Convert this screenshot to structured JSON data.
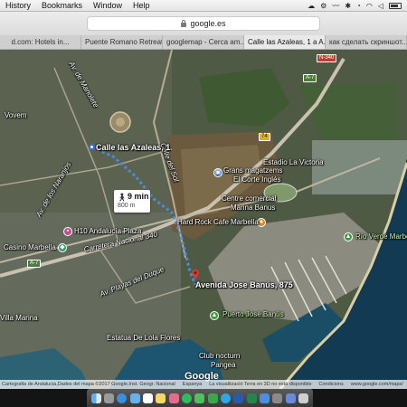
{
  "menubar": {
    "items": [
      "History",
      "Bookmarks",
      "Window",
      "Help"
    ]
  },
  "toolbar": {
    "address": "google.es"
  },
  "tabs": [
    {
      "label": "d.com: Hotels in..."
    },
    {
      "label": "Puente Romano Retreat..."
    },
    {
      "label": "googlemap - Cerca am..."
    },
    {
      "label": "Calle las Azaleas, 1 a A..."
    },
    {
      "label": "как сделать скриншот..."
    }
  ],
  "map": {
    "labels": {
      "vovem": "Vovem",
      "calle_las_azaleas": "Calle las Azaleas, 1",
      "grans_magatzems": "Grans magatzems",
      "el_corte_ingles": "El Corte Inglés",
      "estadio_la_victoria": "Estadio La Victoria",
      "centre_comercial_marina": "Centre comercial",
      "marina_banus": "Marina Banus",
      "hard_rock_cafe": "Hard Rock Cafe Marbella",
      "andalucia_plaza": "H10 Andalucía Plaza",
      "carretera_nacional": "Carretera Nacional 340",
      "casino_marbella": "Casino Marbella",
      "av_playas": "Av. Playas del Duque",
      "avenida_jose_banus": "Avenida Jose Banús, 875",
      "puerto_jose_banus": "Puerto José Banús",
      "rio_verde": "Río Verde Marbella",
      "villa_marina": "Villa Marina",
      "estatua_lola_flores": "Estatua De Lola Flores",
      "club_nocturn": "Club nocturn",
      "pangea": "Pangea",
      "calle_side_1": "Calle del Sol",
      "av_naranjos": "Av. de los Naranjos",
      "av_manolete": "Av. de Manolete",
      "a7_label": "A-7"
    },
    "road_shields": {
      "n340": "N-340",
      "a7": "A-7",
      "ap7": "AP-7",
      "r74": "74"
    },
    "route": {
      "duration": "9 min",
      "distance": "800 m",
      "walk_icon": "walking-person-icon"
    },
    "google_logo": "Google",
    "attribution": [
      "Cartografia de Andalucia,Dades del mapa ©2017 Google,Inst. Geogr. Nacional",
      "Espanya",
      "La visualització Terra en 3D no està disponible",
      "Condicions",
      "www.google.com/maps/"
    ]
  },
  "colors": {
    "route": "#4a8be0",
    "pin_red": "#d93b2f",
    "sea": "#123a52",
    "terrain": "#4e5a44"
  }
}
